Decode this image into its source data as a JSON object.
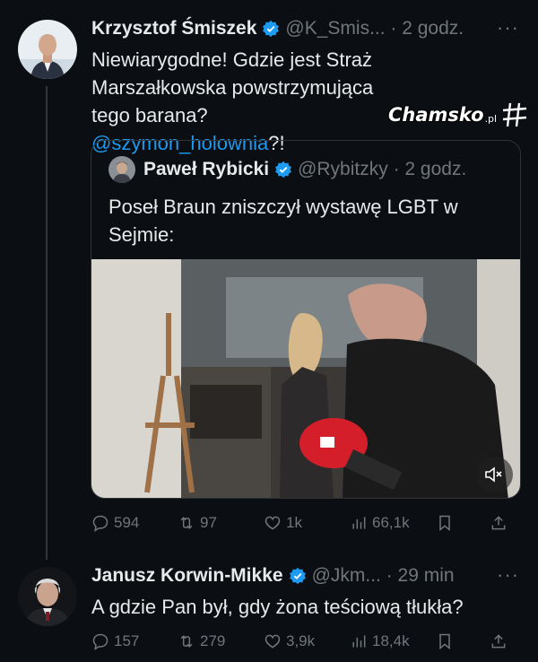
{
  "tweet1": {
    "name": "Krzysztof Śmiszek",
    "handle_time": "@K_Smis... · 2 godz.",
    "text_part1": "Niewiarygodne! Gdzie jest Straż Marszałkowska powstrzymująca tego barana?",
    "mention": "@szymon_holownia",
    "text_part2": "?!"
  },
  "quote": {
    "name": "Paweł Rybicki",
    "handle_time": "@Rybitzky · 2 godz.",
    "text": "Poseł Braun zniszczył wystawę LGBT w Sejmie:"
  },
  "actions1": {
    "replies": "594",
    "retweets": "97",
    "likes": "1k",
    "views": "66,1k"
  },
  "tweet2": {
    "name": "Janusz Korwin-Mikke",
    "handle_time": "@Jkm... · 29 min",
    "text": "A gdzie Pan był, gdy żona teściową tłukła?"
  },
  "actions2": {
    "replies": "157",
    "retweets": "279",
    "likes": "3,9k",
    "views": "18,4k"
  },
  "watermark": {
    "text": "Chamsko",
    "suffix": ".pl"
  },
  "more_glyph": "···",
  "colors": {
    "background": "#0b0e12",
    "accent": "#1d9bf0",
    "verified": "#1d9bf0",
    "muted": "#71767b"
  },
  "icons": [
    "verified-badge-icon",
    "more-icon",
    "reply-icon",
    "retweet-icon",
    "like-icon",
    "views-icon",
    "bookmark-icon",
    "share-icon",
    "mute-icon"
  ]
}
